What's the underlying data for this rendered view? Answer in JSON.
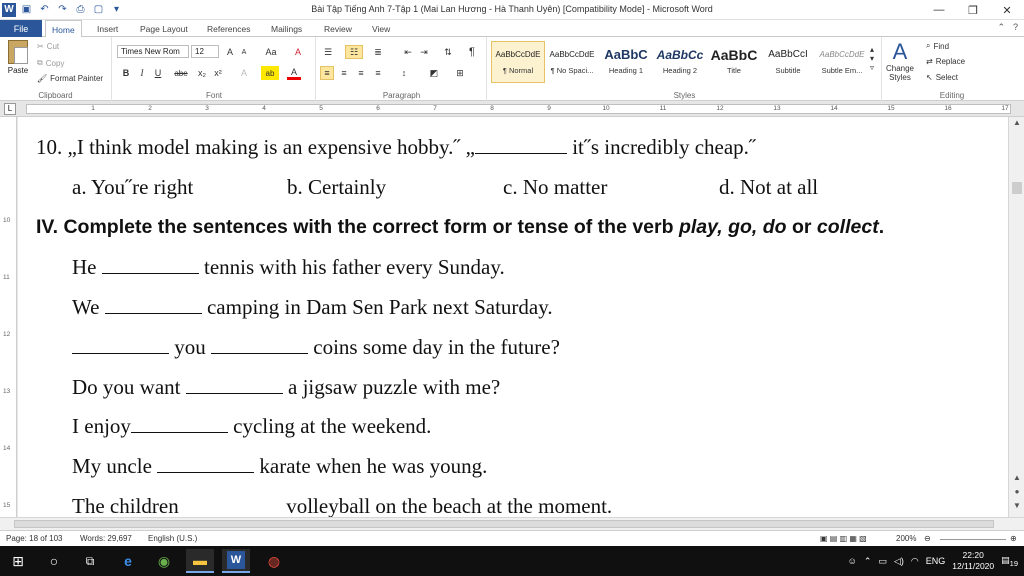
{
  "window": {
    "title": "Bài Tập Tiếng Anh 7-Tập 1 (Mai Lan Hương - Hà Thanh Uyên) [Compatibility Mode]  -  Microsoft Word",
    "minimize": "—",
    "restore": "❐",
    "close": "✕"
  },
  "ribbon_tabs": {
    "file": "File",
    "items": [
      "Home",
      "Insert",
      "Page Layout",
      "References",
      "Mailings",
      "Review",
      "View"
    ]
  },
  "clipboard": {
    "paste": "Paste",
    "cut": "Cut",
    "copy": "Copy",
    "format_painter": "Format Painter",
    "label": "Clipboard"
  },
  "font": {
    "name": "Times New Rom",
    "size": "12",
    "label": "Font",
    "grow": "A",
    "shrink": "A",
    "case": "Aa",
    "clear": "A",
    "bold": "B",
    "italic": "I",
    "underline": "U",
    "strike": "abe",
    "subscript": "x₂",
    "superscript": "x²",
    "effects": "A",
    "highlight": "ab",
    "color": "A"
  },
  "paragraph": {
    "label": "Paragraph",
    "pilcrow": "¶"
  },
  "styles": {
    "label": "Styles",
    "items": [
      {
        "preview": "AaBbCcDdE",
        "name": "¶ Normal"
      },
      {
        "preview": "AaBbCcDdE",
        "name": "¶ No Spaci..."
      },
      {
        "preview": "AaBbC",
        "name": "Heading 1"
      },
      {
        "preview": "AaBbCc",
        "name": "Heading 2"
      },
      {
        "preview": "AaBbC",
        "name": "Title"
      },
      {
        "preview": "AaBbCcI",
        "name": "Subtitle"
      },
      {
        "preview": "AaBbCcDdE",
        "name": "Subtle Em..."
      }
    ],
    "change": "Change Styles"
  },
  "editing": {
    "label": "Editing",
    "find": "Find",
    "replace": "Replace",
    "select": "Select"
  },
  "ruler_marks": [
    "1",
    "2",
    "3",
    "4",
    "5",
    "6",
    "7",
    "8",
    "9",
    "10",
    "11",
    "12",
    "13",
    "14",
    "15",
    "16",
    "17"
  ],
  "vruler_marks": [
    "10",
    "11",
    "12",
    "13",
    "14",
    "15"
  ],
  "document": {
    "q10": {
      "number": "10.",
      "quote": "„I think model making is an expensive hobby.˝ „",
      "tail": " it˝s incredibly cheap.˝",
      "options": [
        "a. You˝re right",
        "b. Certainly",
        "c. No matter",
        "d. Not at all"
      ]
    },
    "section": {
      "prefix": "IV. Complete the sentences with the correct form or tense of the verb ",
      "verbs_1": "play, go, do",
      "or": " or ",
      "verbs_2": "collect",
      "end": "."
    },
    "sentences": [
      {
        "pre": "He ",
        "post": " tennis with his father every Sunday."
      },
      {
        "pre": "We ",
        "post": " camping  in Dam  Sen Park next Saturday."
      },
      {
        "pre": "",
        "mid": " you ",
        "post": " coins some day in the future?"
      },
      {
        "pre": "Do you want ",
        "post": " a jigsaw puzzle with me?"
      },
      {
        "pre": "I enjoy",
        "post": " cycling at the weekend."
      },
      {
        "pre": "My uncle ",
        "post": " karate when he was young."
      },
      {
        "pre": "The children ",
        "post": " volleyball on the beach at the moment."
      }
    ]
  },
  "status": {
    "page": "Page: 18 of 103",
    "words": "Words: 29,697",
    "language": "English (U.S.)",
    "zoom": "200%"
  },
  "taskbar": {
    "lang": "ENG",
    "time": "22:20",
    "date": "12/11/2020",
    "notifications": "19"
  }
}
